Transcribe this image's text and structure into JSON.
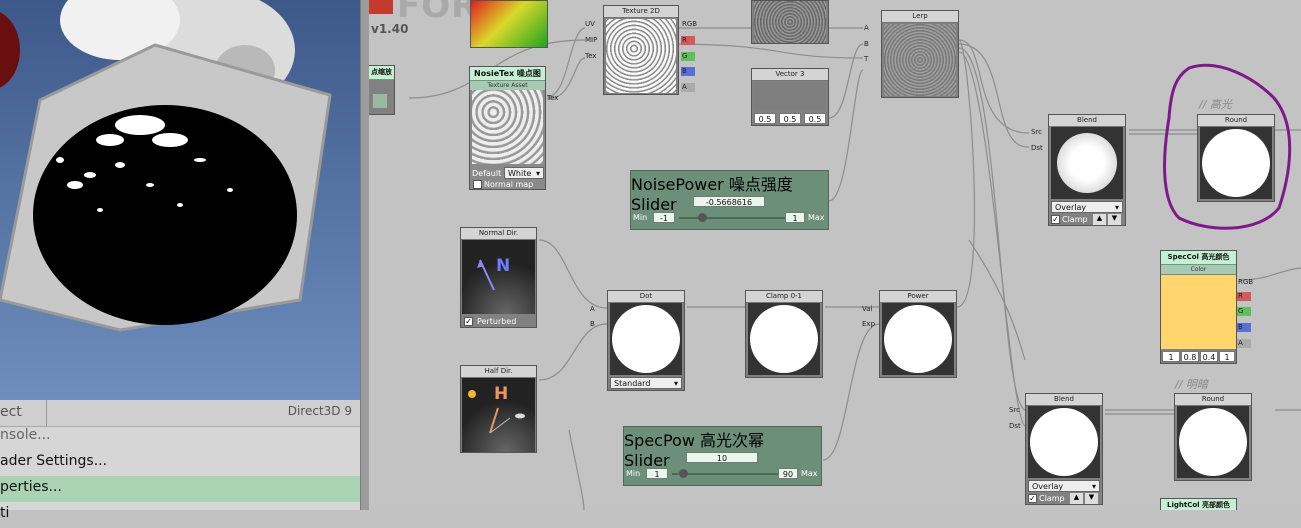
{
  "preview": {
    "panel_items": [
      "ect",
      "nsole...",
      "ader Settings...",
      "perties...",
      "ti"
    ],
    "renderer": "Direct3D 9"
  },
  "graph": {
    "logo": "FORGE",
    "version": "v1.40",
    "partial_node_label": "点缩放",
    "texture2d": {
      "title": "Texture 2D",
      "inputs": [
        "UV",
        "MIP",
        "Tex"
      ],
      "outputs": [
        "RGB",
        "R",
        "G",
        "B",
        "A"
      ]
    },
    "noise_tex": {
      "title": "NosieTex 噪点图",
      "subtitle": "Texture Asset",
      "port": "Tex",
      "default_label": "Default",
      "default_value": "White",
      "normal_map_label": "Normal map"
    },
    "lerp": {
      "title": "Lerp",
      "inputs": [
        "A",
        "B",
        "T"
      ]
    },
    "vector3": {
      "title": "Vector 3",
      "values": [
        "0.5",
        "0.5",
        "0.5"
      ]
    },
    "noise_power": {
      "title": "NoisePower 噪点强度",
      "subtitle": "Slider",
      "value": "-0.5668616",
      "min_label": "Min",
      "min": "-1",
      "max_label": "Max",
      "max": "1",
      "fraction": 0.22
    },
    "blend_top": {
      "title": "Blend",
      "inputs": [
        "Src",
        "Dst"
      ],
      "mode": "Overlay",
      "clamp_label": "Clamp"
    },
    "round_top": {
      "title": "Round",
      "comment": "// 高光"
    },
    "spec_col": {
      "title": "SpecCol 高光颜色",
      "subtitle": "Color",
      "values": [
        "1",
        "0.8",
        "0.4",
        "1"
      ],
      "outputs": [
        "RGB",
        "R",
        "G",
        "B",
        "A"
      ],
      "color": "#ffd66e"
    },
    "normal_dir": {
      "title": "Normal Dir.",
      "glyph": "N",
      "checkbox": "Perturbed"
    },
    "half_dir": {
      "title": "Half Dir.",
      "glyph": "H"
    },
    "dot": {
      "title": "Dot",
      "inputs": [
        "A",
        "B"
      ],
      "mode": "Standard"
    },
    "clamp01": {
      "title": "Clamp 0-1"
    },
    "power": {
      "title": "Power",
      "inputs": [
        "Val",
        "Exp"
      ]
    },
    "spec_pow": {
      "title": "SpecPow 高光次幂",
      "subtitle": "Slider",
      "value": "10",
      "min_label": "Min",
      "min": "1",
      "max_label": "Max",
      "max": "90",
      "fraction": 0.1
    },
    "blend_bottom": {
      "title": "Blend",
      "inputs": [
        "Src",
        "Dst"
      ],
      "mode": "Overlay",
      "clamp_label": "Clamp"
    },
    "round_bottom": {
      "title": "Round",
      "comment": "// 明暗"
    },
    "light_col": {
      "title": "LightCol 亮部颜色"
    }
  },
  "colors": {
    "node_header": "#d4d4d4",
    "property_header": "#c6f0d4",
    "annotation_stroke": "#7d1a8a",
    "r": "#d35a5a",
    "g": "#5fbf5f",
    "b": "#5a6fd3"
  }
}
